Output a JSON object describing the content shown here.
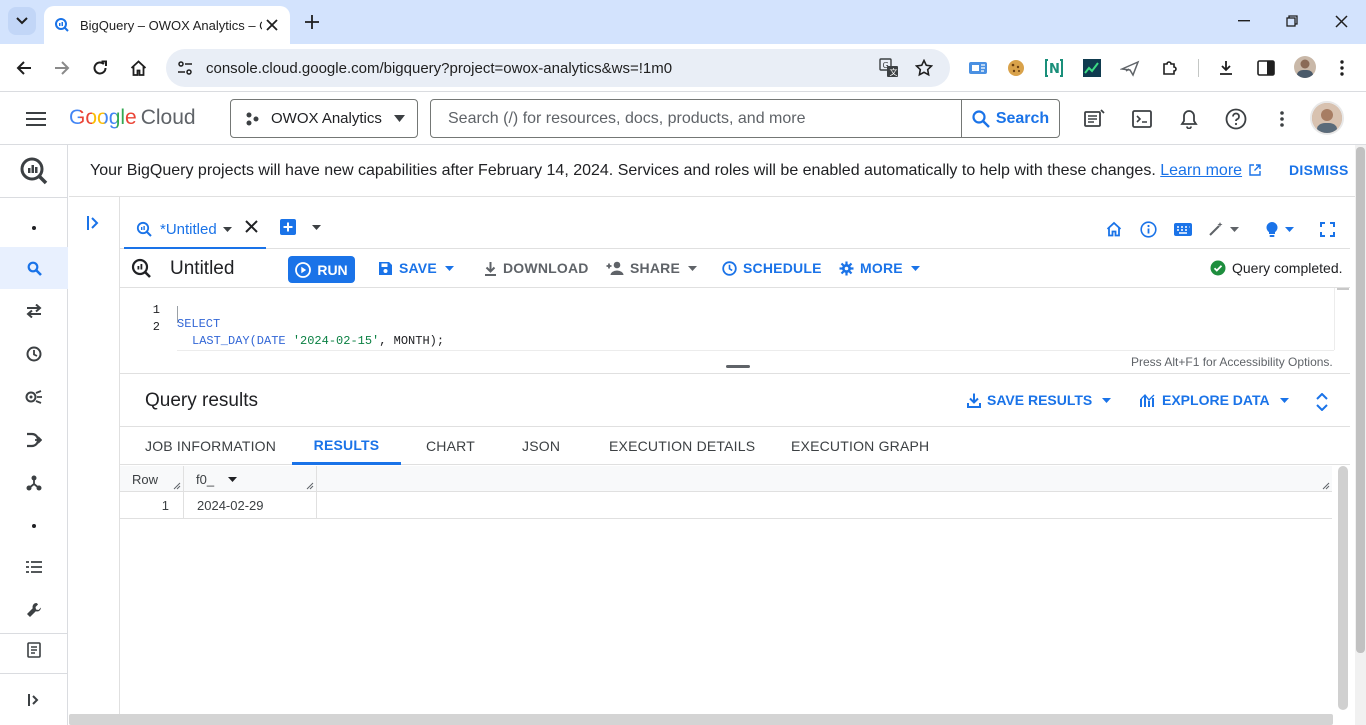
{
  "browser": {
    "tab_title": "BigQuery – OWOX Analytics – G",
    "url": "console.cloud.google.com/bigquery?project=owox-analytics&ws=!1m0"
  },
  "header": {
    "logo_google": "Google",
    "logo_cloud": "Cloud",
    "project_name": "OWOX Analytics",
    "search_placeholder": "Search (/) for resources, docs, products, and more",
    "search_button": "Search"
  },
  "banner": {
    "message": "Your BigQuery projects will have new capabilities after February 14, 2024. Services and roles will be enabled automatically to help with these changes.",
    "learn_more": "Learn more",
    "dismiss": "DISMISS"
  },
  "editor": {
    "tab_label": "*Untitled",
    "title": "Untitled",
    "toolbar": {
      "run": "RUN",
      "save": "SAVE",
      "download": "DOWNLOAD",
      "share": "SHARE",
      "schedule": "SCHEDULE",
      "more": "MORE"
    },
    "status": "Query completed.",
    "code_lines": [
      {
        "num": "1",
        "keyword": "SELECT",
        "text": ""
      },
      {
        "num": "2",
        "func": "LAST_DAY(DATE ",
        "string": "'2024-02-15'",
        "rest": ", MONTH);"
      }
    ],
    "accessibility_hint": "Press Alt+F1 for Accessibility Options."
  },
  "results": {
    "title": "Query results",
    "save_results": "SAVE RESULTS",
    "explore_data": "EXPLORE DATA",
    "tabs": [
      "JOB INFORMATION",
      "RESULTS",
      "CHART",
      "JSON",
      "EXECUTION DETAILS",
      "EXECUTION GRAPH"
    ],
    "active_tab": "RESULTS",
    "columns": {
      "row": "Row",
      "col1": "f0_"
    },
    "rows": [
      {
        "row": "1",
        "f0_": "2024-02-29"
      }
    ]
  },
  "colors": {
    "accent": "#1a73e8",
    "success": "#1e8e3e",
    "tabstrip": "#d3e3fd"
  },
  "icons": {
    "rail": [
      "bigquery-logo-icon",
      "dot-icon",
      "search-icon",
      "transfers-icon",
      "history-icon",
      "analytics-hub-icon",
      "dataform-icon",
      "graph-icon",
      "dot-icon",
      "list-icon",
      "wrench-icon",
      "notes-icon",
      "expand-icon"
    ]
  }
}
